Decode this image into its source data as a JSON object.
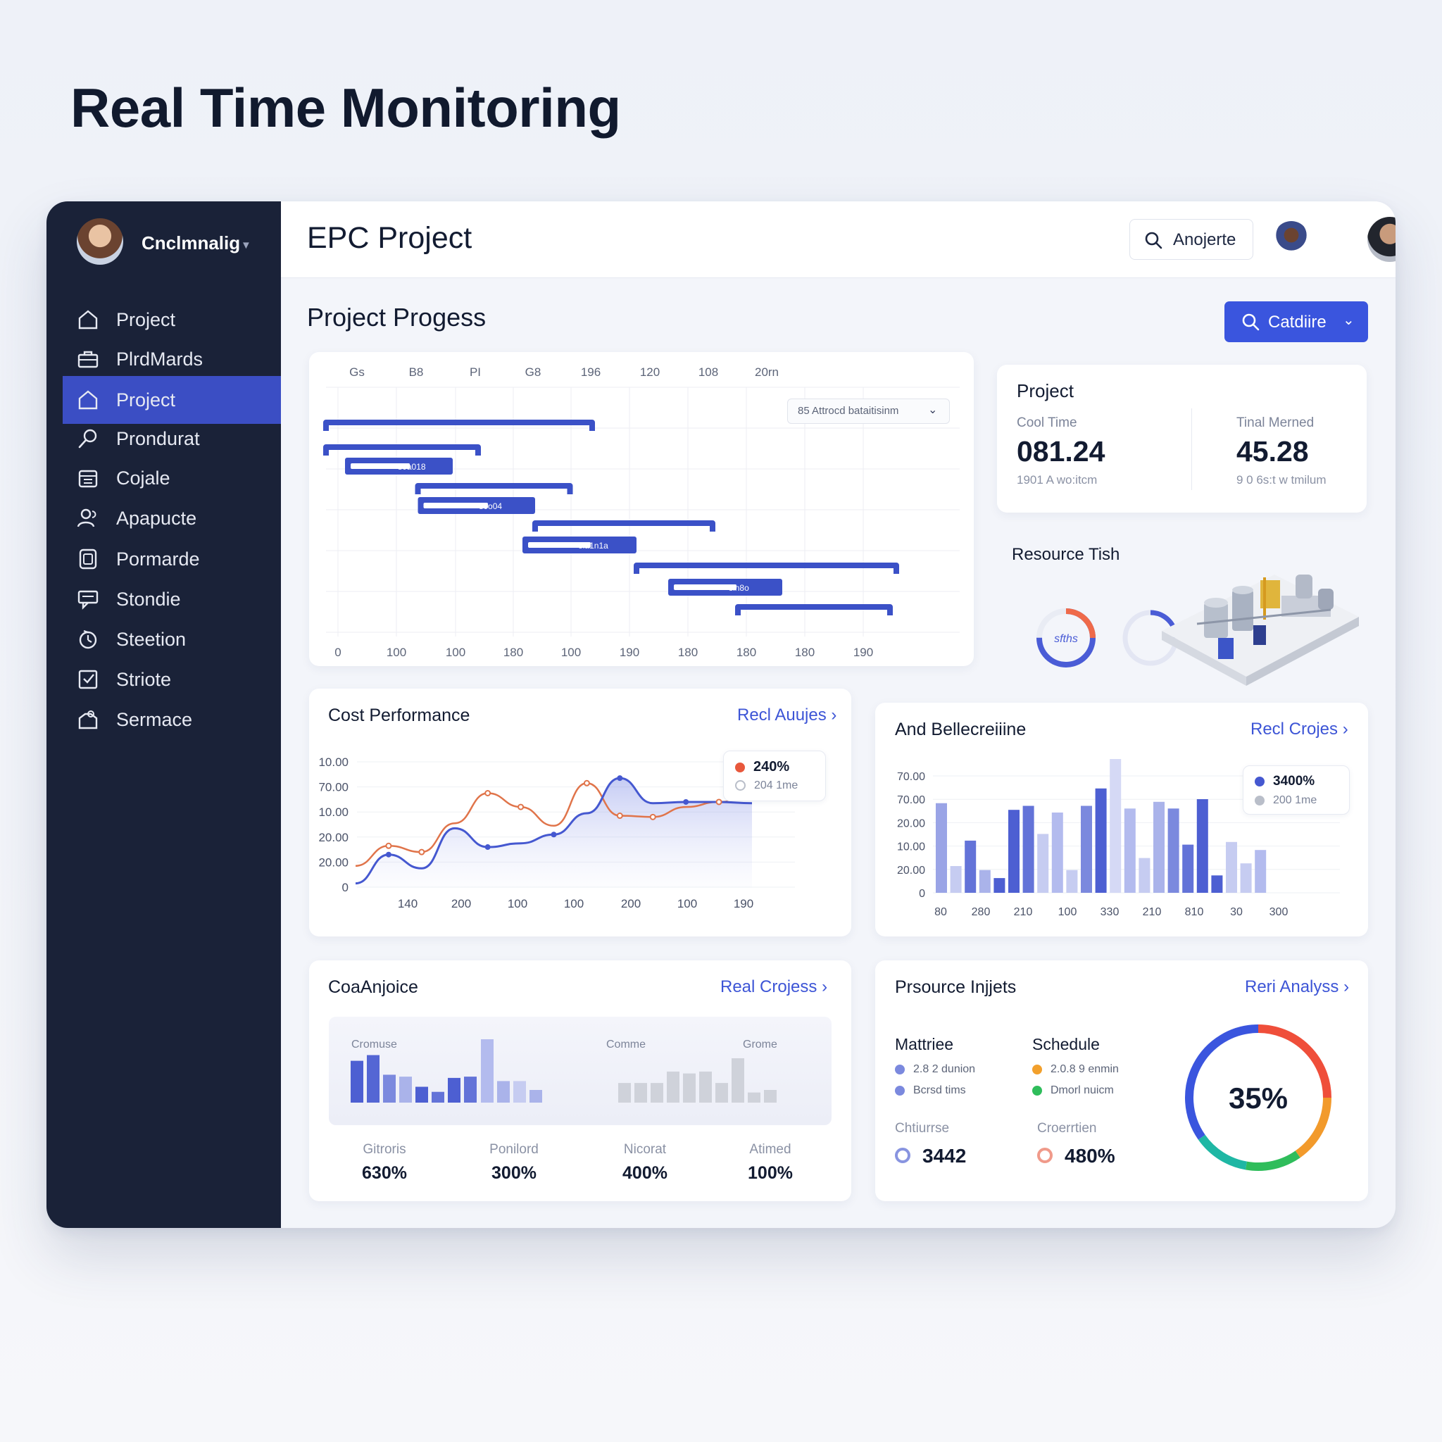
{
  "page_title": "Real Time Monitoring",
  "sidebar": {
    "user_name": "Cnclmnalig",
    "items": [
      {
        "label": "Project",
        "icon": "home-icon",
        "active": false
      },
      {
        "label": "PlrdMards",
        "icon": "briefcase-icon",
        "active": false
      },
      {
        "label": "Project",
        "icon": "home-icon",
        "active": true
      },
      {
        "label": "Prondurat",
        "icon": "search-icon",
        "active": false
      },
      {
        "label": "Cojale",
        "icon": "calendar-icon",
        "active": false
      },
      {
        "label": "Apapucte",
        "icon": "users-icon",
        "active": false
      },
      {
        "label": "Pormarde",
        "icon": "document-icon",
        "active": false
      },
      {
        "label": "Stondie",
        "icon": "message-icon",
        "active": false
      },
      {
        "label": "Steetion",
        "icon": "clock-icon",
        "active": false
      },
      {
        "label": "Striote",
        "icon": "checkbox-icon",
        "active": false
      },
      {
        "label": "Sermace",
        "icon": "toolbox-icon",
        "active": false
      }
    ]
  },
  "header": {
    "title": "EPC Project",
    "search_label": "Anojerte"
  },
  "progress": {
    "heading": "Project Progess",
    "filter_button": "Catdiire",
    "gantt": {
      "top_ticks": [
        "Gs",
        "B8",
        "PI",
        "G8",
        "196",
        "120",
        "108",
        "20rn"
      ],
      "bottom_ticks": [
        "0",
        "100",
        "100",
        "180",
        "100",
        "190",
        "180",
        "180",
        "180",
        "190"
      ],
      "dropdown_label": "85 Attrocd bataitisinm",
      "bars": [
        {
          "start": 0,
          "end": 4.2,
          "label": ""
        },
        {
          "start": 0,
          "end": 2.4,
          "label": ""
        },
        {
          "start": 0.3,
          "end": 2.0,
          "label": "s0a018"
        },
        {
          "start": 1.45,
          "end": 3.85,
          "label": ""
        },
        {
          "start": 1.45,
          "end": 3.3,
          "label": "s0o04"
        },
        {
          "start": 3.3,
          "end": 6.1,
          "label": ""
        },
        {
          "start": 3.1,
          "end": 4.9,
          "label": "eia1n1a"
        },
        {
          "start": 4.9,
          "end": 9.0,
          "label": ""
        },
        {
          "start": 5.4,
          "end": 7.2,
          "label": "sin8o"
        },
        {
          "start": 6.5,
          "end": 8.9,
          "label": ""
        }
      ]
    }
  },
  "project_stats": {
    "title": "Project",
    "left": {
      "label": "Cool Time",
      "value": "081.24",
      "sub": "1901 A wo:itcm"
    },
    "right": {
      "label": "Tinal Merned",
      "value": "45.28",
      "sub": "9 0 6s:t w tmilum"
    }
  },
  "resource": {
    "title": "Resource Tish",
    "gauge_label": "sfths",
    "gauge1_fraction": 0.75,
    "gauge2_fraction": 0.25
  },
  "cost_performance": {
    "title": "Cost Performance",
    "link": "Recl Auujes",
    "legend": [
      {
        "value": "240%",
        "color": "#e8583c"
      },
      {
        "value": "204 1me",
        "color": "#b9bec9"
      }
    ],
    "chart_data": {
      "type": "line",
      "y_tick_labels": [
        "10.00",
        "70.00",
        "10.00",
        "20.00",
        "20.00",
        "0"
      ],
      "x_tick_labels": [
        "140",
        "200",
        "100",
        "100",
        "200",
        "100",
        "190"
      ],
      "series": [
        {
          "color": "#4558d0",
          "values": [
            0.03,
            0.26,
            0.15,
            0.47,
            0.32,
            0.35,
            0.42,
            0.59,
            0.87,
            0.67,
            0.68,
            0.68,
            0.67
          ]
        },
        {
          "color": "#e0744a",
          "values": [
            0.17,
            0.33,
            0.28,
            0.51,
            0.75,
            0.64,
            0.49,
            0.83,
            0.57,
            0.56,
            0.64,
            0.68,
            0.72
          ]
        }
      ]
    }
  },
  "allocation": {
    "title": "And Bellecreiiine",
    "link": "Recl Crojes",
    "legend": [
      {
        "value": "3400%",
        "color": "#4558d0"
      },
      {
        "value": "200 1me",
        "color": "#b9bec9"
      }
    ],
    "chart_data": {
      "type": "bar",
      "y_tick_labels": [
        "70.00",
        "70.00",
        "20.00",
        "10.00",
        "20.00",
        "0"
      ],
      "x_tick_labels": [
        "80",
        "280",
        "210",
        "100",
        "330",
        "210",
        "810",
        "30",
        "300"
      ],
      "values": [
        0.67,
        0.2,
        0.39,
        0.17,
        0.11,
        0.62,
        0.65,
        0.44,
        0.6,
        0.17,
        0.65,
        0.78,
        1.0,
        0.63,
        0.26,
        0.68,
        0.63,
        0.36,
        0.7,
        0.13,
        0.38,
        0.22,
        0.32
      ],
      "shades": [
        "#9aa4e6",
        "#c6ccf1",
        "#6373d8",
        "#aab3ea",
        "#4d5fd2",
        "#4d5fd2",
        "#6373d8",
        "#c6ccf1",
        "#b3bbee",
        "#c6ccf1",
        "#7b89de",
        "#4d5fd2",
        "#d5d9f5",
        "#b3bbee",
        "#c6ccf1",
        "#aab3ea",
        "#7b89de",
        "#6373d8",
        "#4d5fd2",
        "#4d5fd2",
        "#c6ccf1",
        "#c6ccf1",
        "#b3bbee"
      ]
    }
  },
  "coanjoice": {
    "title": "CoaAnjoice",
    "link": "Real Crojess",
    "mini_labels": [
      "Cromuse",
      "Comme",
      "Grome"
    ],
    "stats": [
      {
        "label": "Gitroris",
        "value": "630%"
      },
      {
        "label": "Ponilord",
        "value": "300%"
      },
      {
        "label": "Nicorat",
        "value": "400%"
      },
      {
        "label": "Atimed",
        "value": "100%"
      }
    ],
    "chart_data": {
      "type": "bar",
      "values": [
        0.66,
        0.75,
        0.44,
        0.41,
        0.25,
        0.17,
        0.39,
        0.41,
        1.0,
        0.34,
        0.34,
        0.2,
        0.31,
        0.31,
        0.31,
        0.49,
        0.46,
        0.49,
        0.31,
        0.7,
        0.16,
        0.2
      ],
      "colors": [
        "#4d5fd2",
        "#5466d4",
        "#7b89de",
        "#aab3ea",
        "#4d5fd2",
        "#6373d8",
        "#4d5fd2",
        "#6373d8",
        "#b3bbee",
        "#aab3ea",
        "#c6ccf1",
        "#aab3ea",
        "#cfd2da",
        "#cfd2da",
        "#cfd2da",
        "#cfd2da",
        "#cfd2da",
        "#cfd2da",
        "#cfd2da",
        "#cfd2da",
        "#cfd2da",
        "#cfd2da"
      ]
    }
  },
  "pressure": {
    "title": "Prsource Injjets",
    "link": "Reri Analyss",
    "col1": {
      "title": "Mattriee",
      "items": [
        {
          "text": "2.8 2 dunion",
          "color": "#7b89de"
        },
        {
          "text": "Bcrsd tims",
          "color": "#7b89de"
        }
      ]
    },
    "col2": {
      "title": "Schedule",
      "items": [
        {
          "text": "2.0.8 9 enmin",
          "color": "#f2a02c"
        },
        {
          "text": "Dmorl nuicm",
          "color": "#2fbd5b"
        }
      ]
    },
    "stat1": {
      "label": "Chtiurrse",
      "value": "3442",
      "color": "#8894e0"
    },
    "stat2": {
      "label": "Croerrtien",
      "value": "480%",
      "color": "#f09a8a"
    },
    "donut": {
      "value": "35%",
      "fraction": 0.35
    }
  }
}
